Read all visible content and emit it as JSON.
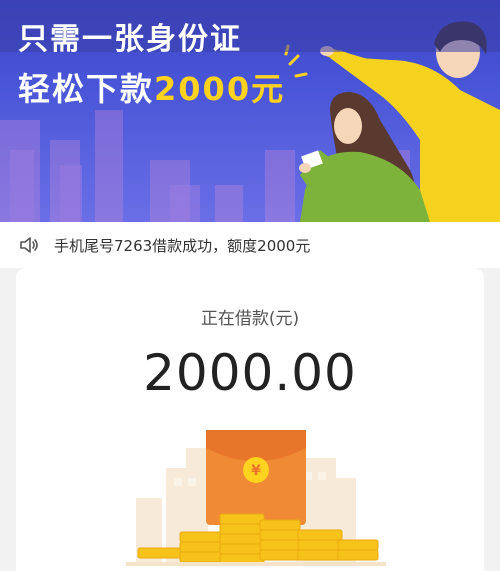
{
  "banner": {
    "line1": "只需一张身份证",
    "line2_prefix": "轻松下款",
    "line2_amount": "2000元"
  },
  "notice": {
    "text": "手机尾号7263借款成功，额度2000元",
    "icon": "speaker-icon"
  },
  "loan": {
    "label": "正在借款(元)",
    "amount": "2000.00"
  },
  "colors": {
    "banner_bg": "#4a56d8",
    "accent_yellow": "#ffd21f",
    "envelope_orange": "#f08a35",
    "coin_gold": "#f7c21a"
  }
}
